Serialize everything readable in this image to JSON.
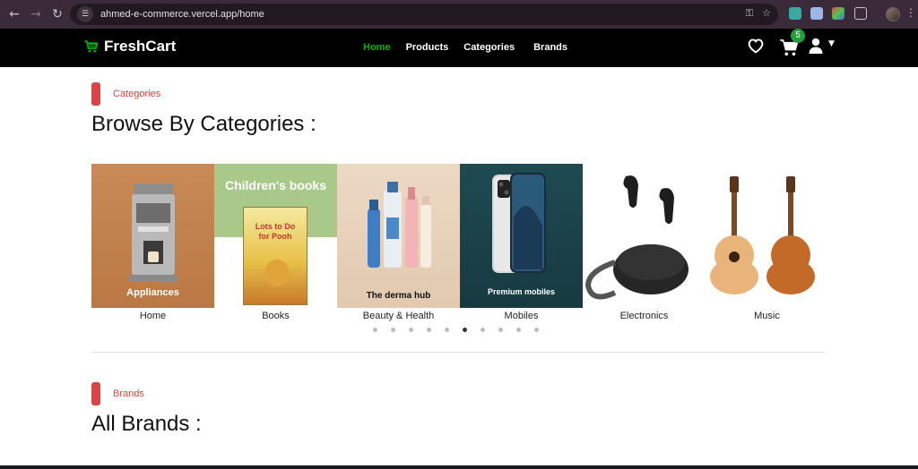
{
  "browser": {
    "url": "ahmed-e-commerce.vercel.app/home",
    "back_icon": "arrow-left-icon",
    "forward_icon": "arrow-right-icon",
    "reload_icon": "reload-icon"
  },
  "navbar": {
    "brand": "FreshCart",
    "links": [
      {
        "label": "Home",
        "active": true
      },
      {
        "label": "Products",
        "active": false
      },
      {
        "label": "Categories",
        "active": false
      },
      {
        "label": "Brands",
        "active": false
      }
    ],
    "cart_count": "5",
    "accent_color": "#0aad0a"
  },
  "categories_section": {
    "tag": "Categories",
    "heading": "Browse By Categories :",
    "items": [
      {
        "label": "Home",
        "overlay": "Appliances"
      },
      {
        "label": "Books",
        "overlay": "Children's books"
      },
      {
        "label": "Beauty & Health",
        "overlay": "The derma hub"
      },
      {
        "label": "Mobiles",
        "overlay": "Premium mobiles"
      },
      {
        "label": "Electronics",
        "overlay": ""
      },
      {
        "label": "Music",
        "overlay": ""
      }
    ],
    "book_cover_text": "Lots to Do for Pooh",
    "pagination_total": 10,
    "pagination_active": 6
  },
  "brands_section": {
    "tag": "Brands",
    "heading": "All Brands :"
  }
}
